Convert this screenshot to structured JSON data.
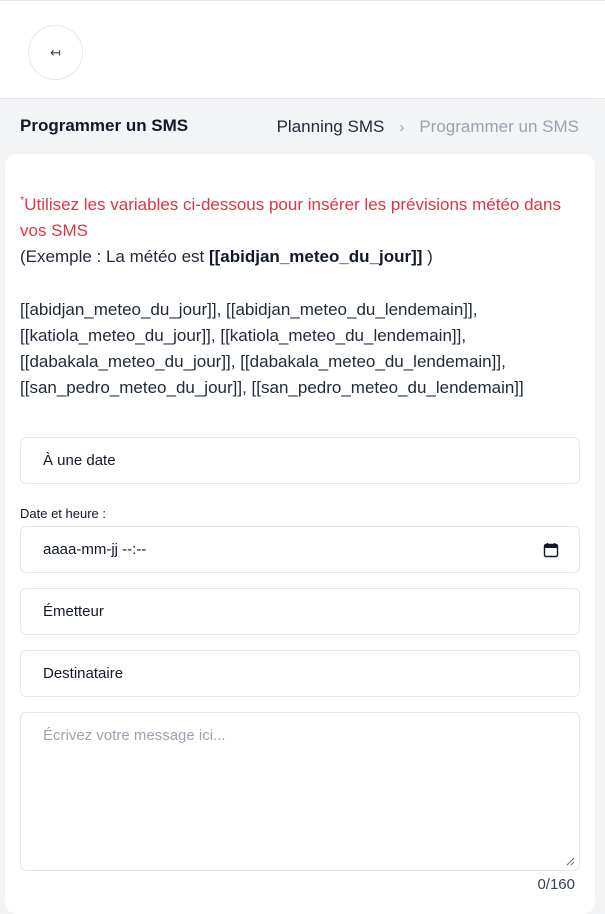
{
  "header": {
    "back_icon_glyph": "↤",
    "back_icon": "arrow-left-to-bar-icon"
  },
  "page": {
    "title": "Programmer un SMS"
  },
  "breadcrumb": {
    "link": "Planning SMS",
    "separator": "›",
    "current": "Programmer un SMS"
  },
  "notice": {
    "asterisk": "*",
    "warning": "Utilisez les variables ci-dessous pour insérer les prévisions météo dans vos SMS",
    "example_prefix": "(Exemple : La météo est ",
    "example_variable": "[[abidjan_meteo_du_jour]]",
    "example_suffix": " )"
  },
  "variables": [
    "[[abidjan_meteo_du_jour]], [[abidjan_meteo_du_lendemain]],",
    "[[katiola_meteo_du_jour]], [[katiola_meteo_du_lendemain]],",
    "[[dabakala_meteo_du_jour]], [[dabakala_meteo_du_lendemain]],",
    "[[san_pedro_meteo_du_jour]], [[san_pedro_meteo_du_lendemain]]"
  ],
  "form": {
    "schedule_type": "À une date",
    "datetime_label": "Date et heure :",
    "datetime_value": "aaaa-mm-jj --:--",
    "sender": "Émetteur",
    "recipient": "Destinataire",
    "message_placeholder": "Écrivez votre message ici...",
    "counter": "0/160"
  },
  "colors": {
    "warning": "#dc3545",
    "muted": "#9ca3af"
  }
}
